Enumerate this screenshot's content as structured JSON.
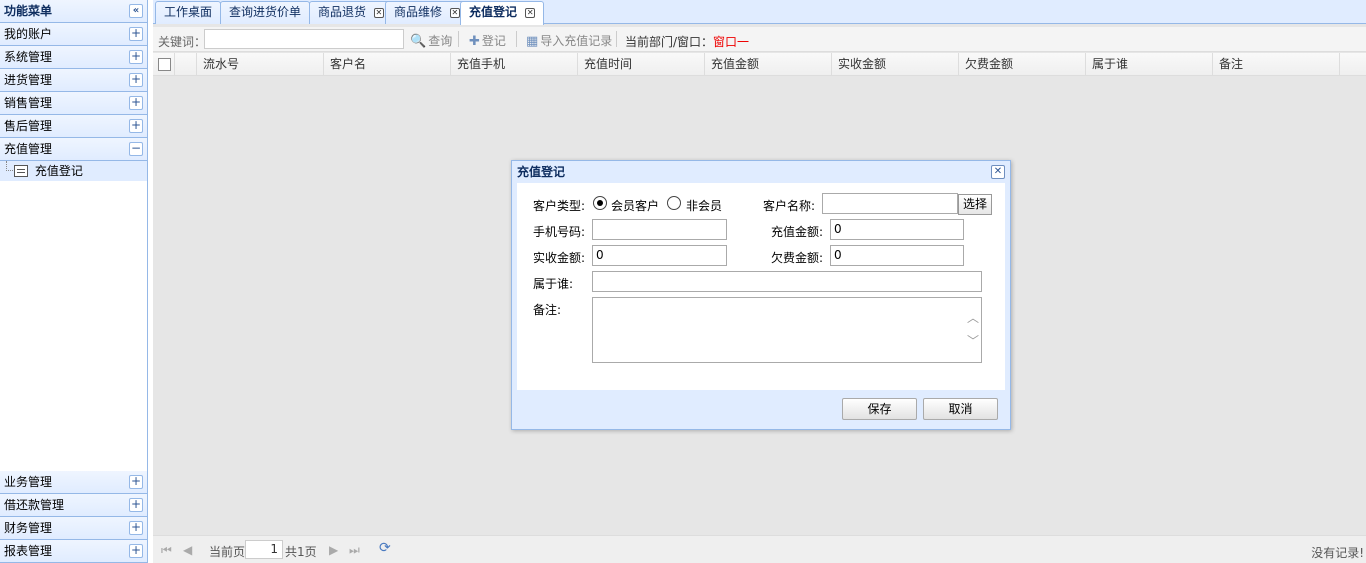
{
  "sidebar": {
    "title": "功能菜单",
    "collapse_icon": "«",
    "groups_top": [
      {
        "label": "我的账户",
        "toggle": "+"
      },
      {
        "label": "系统管理",
        "toggle": "+"
      },
      {
        "label": "进货管理",
        "toggle": "+"
      },
      {
        "label": "销售管理",
        "toggle": "+"
      },
      {
        "label": "售后管理",
        "toggle": "+"
      },
      {
        "label": "充值管理",
        "toggle": "−"
      }
    ],
    "open_child": "充值登记",
    "groups_bottom": [
      {
        "label": "业务管理",
        "toggle": "+"
      },
      {
        "label": "借还款管理",
        "toggle": "+"
      },
      {
        "label": "财务管理",
        "toggle": "+"
      },
      {
        "label": "报表管理",
        "toggle": "+"
      }
    ]
  },
  "tabs": [
    {
      "label": "工作桌面"
    },
    {
      "label": "查询进货价单"
    },
    {
      "label": "商品退货"
    },
    {
      "label": "商品维修"
    },
    {
      "label": "充值登记"
    }
  ],
  "toolbar": {
    "keyword_label": "关键词：",
    "keyword_value": "",
    "search_label": "查询",
    "register_label": "登记",
    "import_label": "导入充值记录",
    "dept_label": "当前部门/窗口：",
    "dept_value": "窗口一"
  },
  "grid": {
    "columns": [
      "流水号",
      "客户名",
      "充值手机",
      "充值时间",
      "充值金额",
      "实收金额",
      "欠费金额",
      "属于谁",
      "备注"
    ]
  },
  "pager": {
    "current_label": "当前页",
    "page_value": "1",
    "total_label": "共1页",
    "no_record": "没有记录!"
  },
  "dialog": {
    "title": "充值登记",
    "customer_type_label": "客户类型:",
    "option_member": "会员客户",
    "option_nonmember": "非会员",
    "customer_name_label": "客户名称:",
    "customer_name_value": "",
    "select_button": "选择",
    "phone_label": "手机号码:",
    "phone_value": "",
    "amount_label": "充值金额:",
    "amount_value": "0",
    "received_label": "实收金额:",
    "received_value": "0",
    "arrears_label": "欠费金额:",
    "arrears_value": "0",
    "owner_label": "属于谁:",
    "owner_value": "",
    "remark_label": "备注:",
    "remark_value": "",
    "save_button": "保存",
    "cancel_button": "取消"
  }
}
